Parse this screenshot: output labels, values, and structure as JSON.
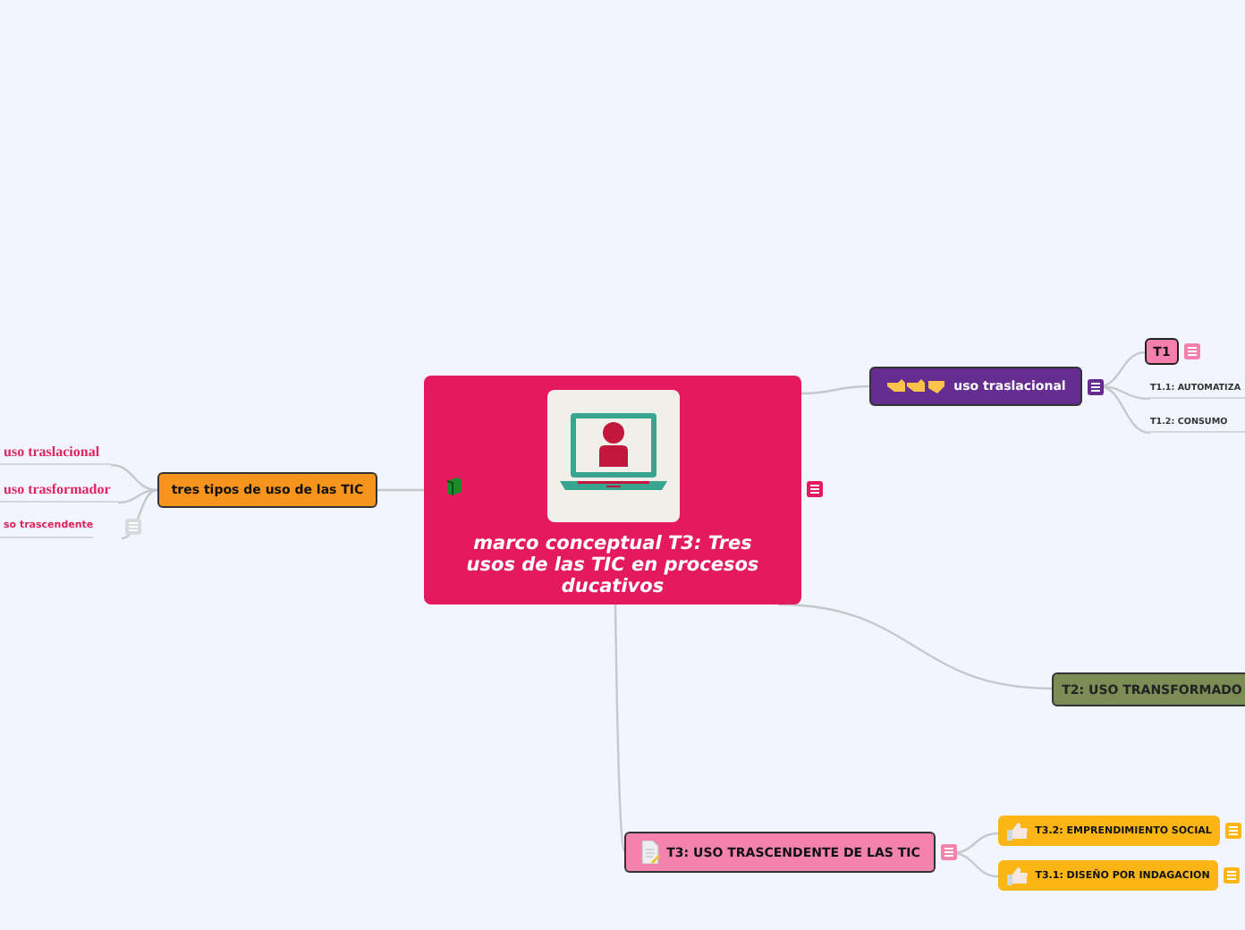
{
  "central_topic": {
    "title": "marco conceptual T3: Tres usos de las TIC en procesos ducativos",
    "color": "#e51a5e",
    "has_note": true
  },
  "topics": [
    {
      "kind": "main",
      "label": "tres tipos de uso de las TIC",
      "color": "#f7941d",
      "has_note": false,
      "children": [
        {
          "kind": "text",
          "label": "uso traslacional",
          "has_note": false
        },
        {
          "kind": "text",
          "label": "uso trasformador",
          "has_note": false
        },
        {
          "kind": "text",
          "label": "so trascendente",
          "has_note": true
        }
      ]
    },
    {
      "kind": "main",
      "label": "uso traslacional",
      "color": "#662d91",
      "has_note": true,
      "children": [
        {
          "kind": "sub",
          "label": "T1",
          "color": "#f77fad",
          "has_note": true
        },
        {
          "kind": "text",
          "label": "T1.1: AUTOMATIZA",
          "has_note": false
        },
        {
          "kind": "text",
          "label": "T1.2: CONSUMO",
          "has_note": false
        }
      ]
    },
    {
      "kind": "main",
      "label": "T2: USO TRANSFORMADO",
      "color": "#7b8c54",
      "has_note": false
    },
    {
      "kind": "main",
      "label": "T3: USO TRASCENDENTE DE LAS TIC",
      "color": "#f383ad",
      "has_note": true,
      "children": [
        {
          "kind": "sub",
          "label": "T3.2: EMPRENDIMIENTO SOCIAL",
          "color": "#fbb616",
          "has_note": true
        },
        {
          "kind": "sub",
          "label": "T3.1: DISEÑO POR INDAGACION",
          "color": "#fbb616",
          "has_note": true
        }
      ]
    }
  ]
}
